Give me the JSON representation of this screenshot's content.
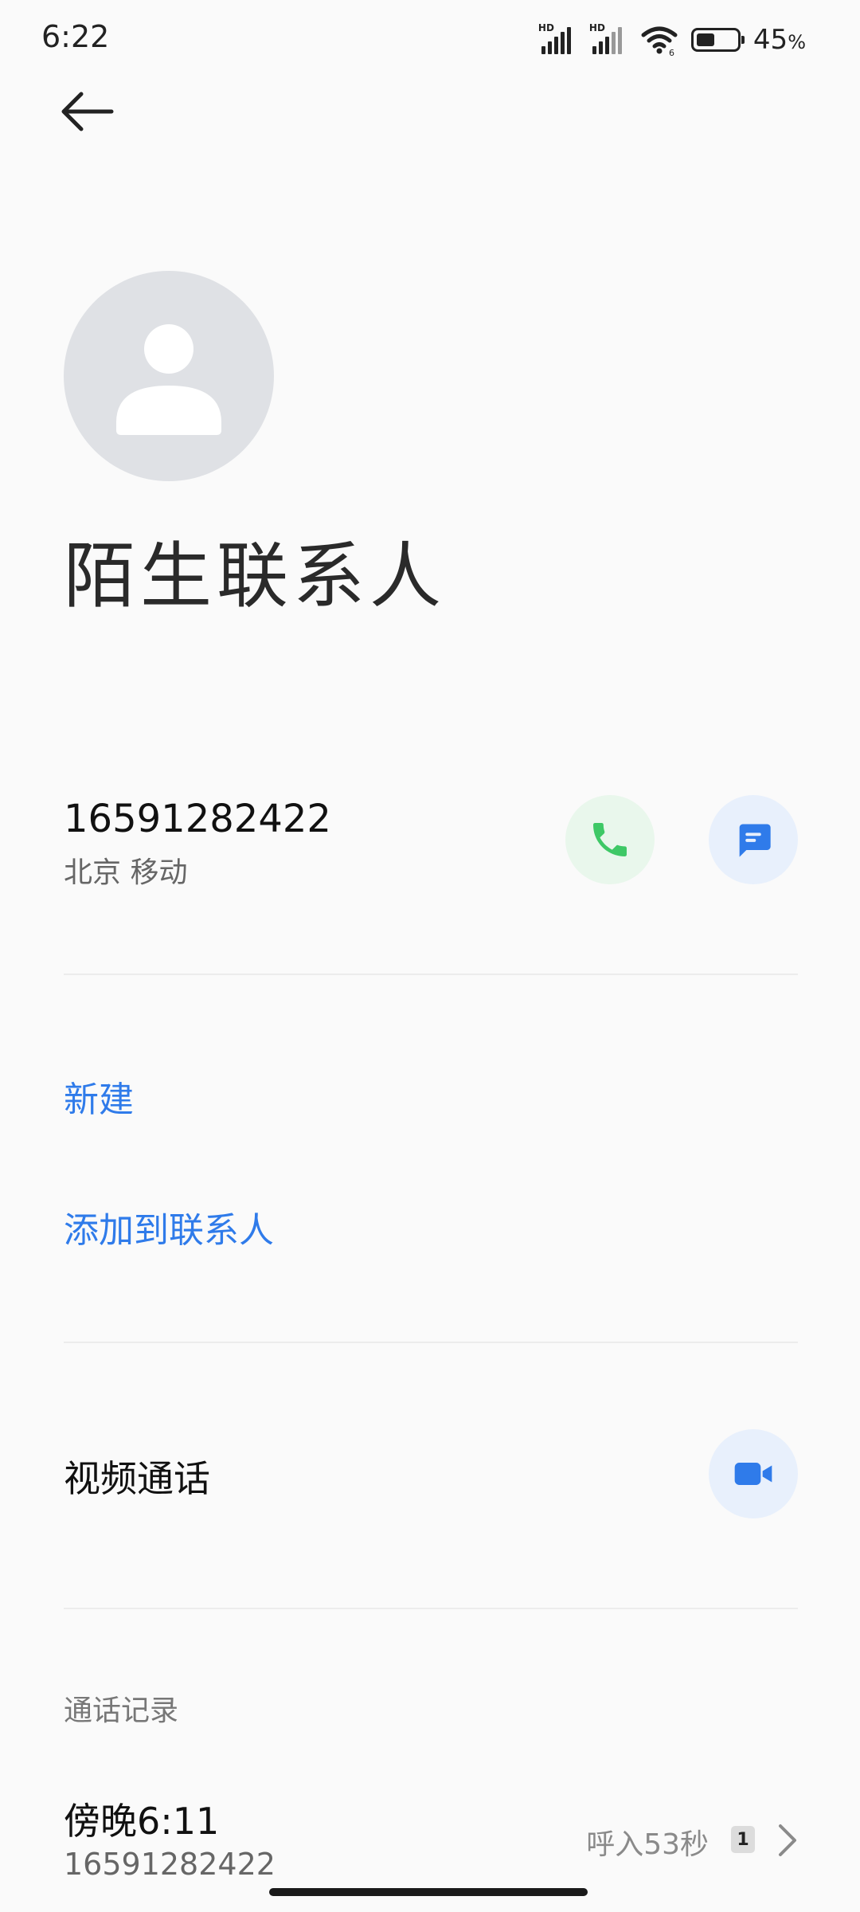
{
  "status_bar": {
    "time": "6:22",
    "hd_label": "HD",
    "battery_percent": 45,
    "battery_text": "45",
    "battery_unit": "%"
  },
  "contact": {
    "name": "陌生联系人",
    "number": "16591282422",
    "location": "北京 移动"
  },
  "actions": {
    "new_label": "新建",
    "add_to_contacts_label": "添加到联系人",
    "video_call_label": "视频通话"
  },
  "call_log": {
    "title": "通话记录",
    "items": [
      {
        "time": "傍晚6:11",
        "number": "16591282422",
        "detail": "呼入53秒",
        "sim": "1"
      }
    ]
  },
  "colors": {
    "accent": "#2f7bea",
    "call_green": "#3ec866",
    "call_bg": "#e9f7ec",
    "blue_bg": "#e8f0fc",
    "avatar_bg": "#dfe1e5"
  },
  "icons": {
    "back": "arrow-left-icon",
    "avatar": "person-icon",
    "call": "phone-icon",
    "message": "message-icon",
    "video": "video-camera-icon",
    "chevron": "chevron-right-icon"
  }
}
